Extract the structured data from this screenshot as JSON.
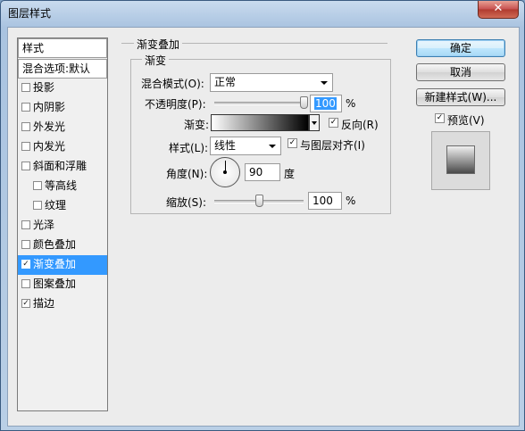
{
  "window": {
    "title": "图层样式",
    "close_glyph": "✕"
  },
  "left_list": {
    "header": "样式",
    "blend_options": "混合选项:默认",
    "items": [
      {
        "label": "投影",
        "checked": false,
        "indent": false,
        "selected": false
      },
      {
        "label": "内阴影",
        "checked": false,
        "indent": false,
        "selected": false
      },
      {
        "label": "外发光",
        "checked": false,
        "indent": false,
        "selected": false
      },
      {
        "label": "内发光",
        "checked": false,
        "indent": false,
        "selected": false
      },
      {
        "label": "斜面和浮雕",
        "checked": false,
        "indent": false,
        "selected": false
      },
      {
        "label": "等高线",
        "checked": false,
        "indent": true,
        "selected": false
      },
      {
        "label": "纹理",
        "checked": false,
        "indent": true,
        "selected": false
      },
      {
        "label": "光泽",
        "checked": false,
        "indent": false,
        "selected": false
      },
      {
        "label": "颜色叠加",
        "checked": false,
        "indent": false,
        "selected": false
      },
      {
        "label": "渐变叠加",
        "checked": true,
        "indent": false,
        "selected": true
      },
      {
        "label": "图案叠加",
        "checked": false,
        "indent": false,
        "selected": false
      },
      {
        "label": "描边",
        "checked": true,
        "indent": false,
        "selected": false
      }
    ]
  },
  "gradient_overlay": {
    "section_title": "渐变叠加",
    "group_title": "渐变",
    "blend_mode_label": "混合模式(O):",
    "blend_mode_value": "正常",
    "opacity_label": "不透明度(P):",
    "opacity_value": "100",
    "opacity_fraction": 1.0,
    "percent_sign": "%",
    "gradient_label": "渐变:",
    "reverse_label": "反向(R)",
    "reverse_checked": true,
    "style_label": "样式(L):",
    "style_value": "线性",
    "align_label": "与图层对齐(I)",
    "align_checked": true,
    "angle_label": "角度(N):",
    "angle_value": "90",
    "degree_label": "度",
    "scale_label": "缩放(S):",
    "scale_value": "100",
    "scale_fraction": 0.5,
    "scale_percent_sign": "%"
  },
  "buttons": {
    "ok": "确定",
    "cancel": "取消",
    "new_style": "新建样式(W)...",
    "preview_label": "预览(V)",
    "preview_checked": true
  },
  "colors": {
    "selection": "#3399ff",
    "gradient_start": "#ffffff",
    "gradient_end": "#000000"
  }
}
